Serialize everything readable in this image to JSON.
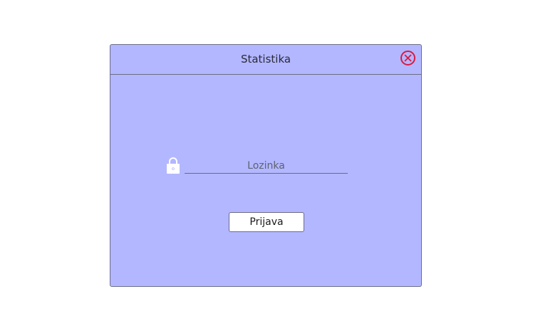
{
  "dialog": {
    "title": "Statistika",
    "close_icon": "close-x-circle-icon",
    "password": {
      "placeholder": "Lozinka",
      "value": "",
      "icon": "lock-icon"
    },
    "login_label": "Prijava"
  },
  "colors": {
    "dialog_background": "#b3b7ff",
    "close_accent": "#d81b44",
    "button_background": "#ffffff"
  }
}
